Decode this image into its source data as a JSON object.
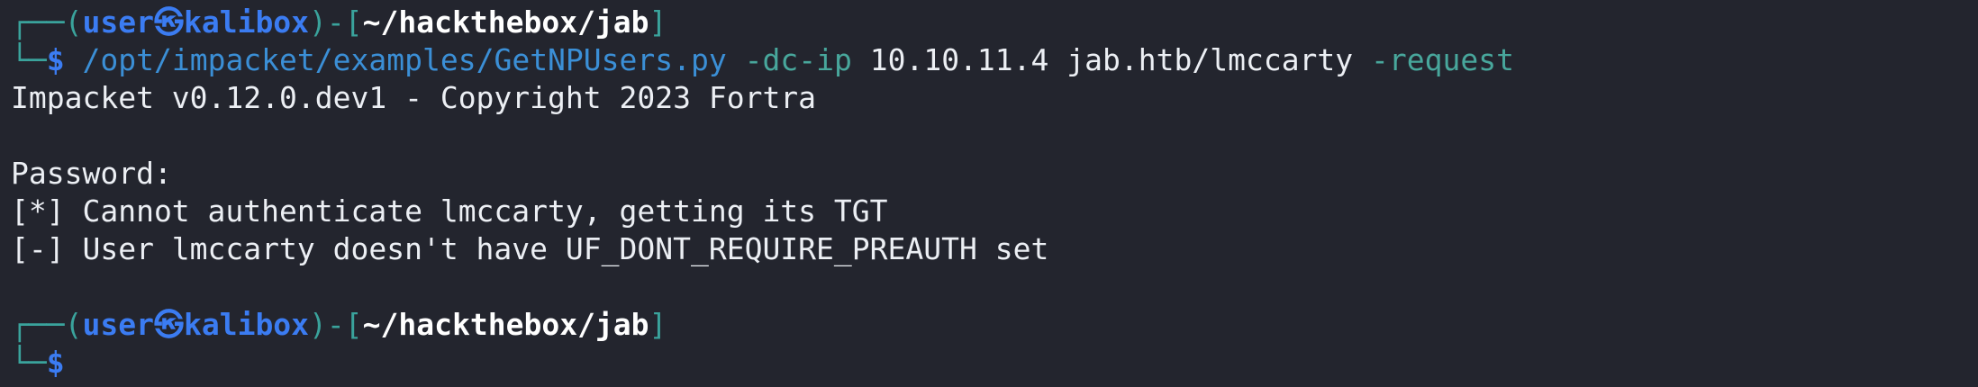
{
  "prompt": {
    "frame_top_left": "┌──(",
    "user": "user",
    "separator": "㉿",
    "host": "kalibox",
    "frame_mid": ")-[",
    "cwd": "~/hackthebox/jab",
    "frame_end": "]",
    "frame_bottom_left": "└─",
    "symbol": "$"
  },
  "command": {
    "program": "/opt/impacket/examples/GetNPUsers.py",
    "flag_dc_ip": "-dc-ip",
    "ip": "10.10.11.4",
    "target": "jab.htb/lmccarty",
    "flag_request": "-request"
  },
  "output": [
    "Impacket v0.12.0.dev1 - Copyright 2023 Fortra",
    "",
    "Password:",
    "[*] Cannot authenticate lmccarty, getting its TGT",
    "[-] User lmccarty doesn't have UF_DONT_REQUIRE_PREAUTH set"
  ],
  "colors": {
    "background": "#23252e",
    "prompt_accent": "#3b7cf2",
    "frame": "#3aa39c",
    "command": "#3b8fd6",
    "flag": "#48a79c",
    "text": "#eceff4"
  }
}
